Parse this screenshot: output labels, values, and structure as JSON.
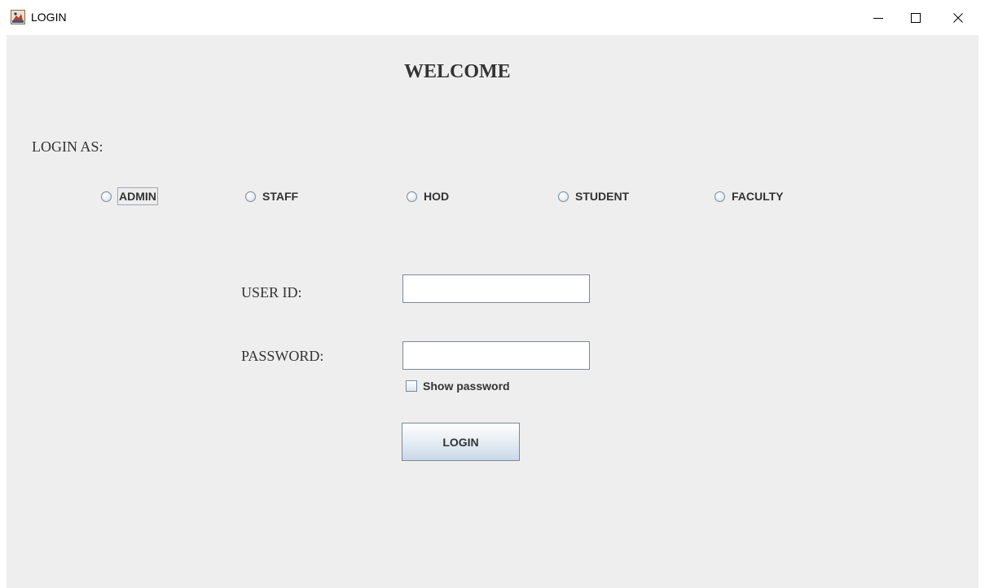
{
  "window": {
    "title": "LOGIN",
    "icon": "java-app-icon",
    "controls": {
      "minimize": "minimize-icon",
      "maximize": "maximize-icon",
      "close": "close-icon"
    }
  },
  "form": {
    "welcome": "WELCOME",
    "login_as_label": "LOGIN AS:",
    "roles": [
      {
        "label": "ADMIN",
        "selected": false,
        "focused": true
      },
      {
        "label": "STAFF",
        "selected": false
      },
      {
        "label": "HOD",
        "selected": false
      },
      {
        "label": "STUDENT",
        "selected": false
      },
      {
        "label": "FACULTY",
        "selected": false
      }
    ],
    "user_id_label": "USER ID:",
    "user_id_value": "",
    "password_label": "PASSWORD:",
    "password_value": "",
    "show_password_label": "Show password",
    "show_password_checked": false,
    "login_button_label": "LOGIN"
  },
  "colors": {
    "content_background": "#eeeeee",
    "titlebar_background": "#ffffff",
    "text": "#333333",
    "border": "#7a8a99"
  }
}
